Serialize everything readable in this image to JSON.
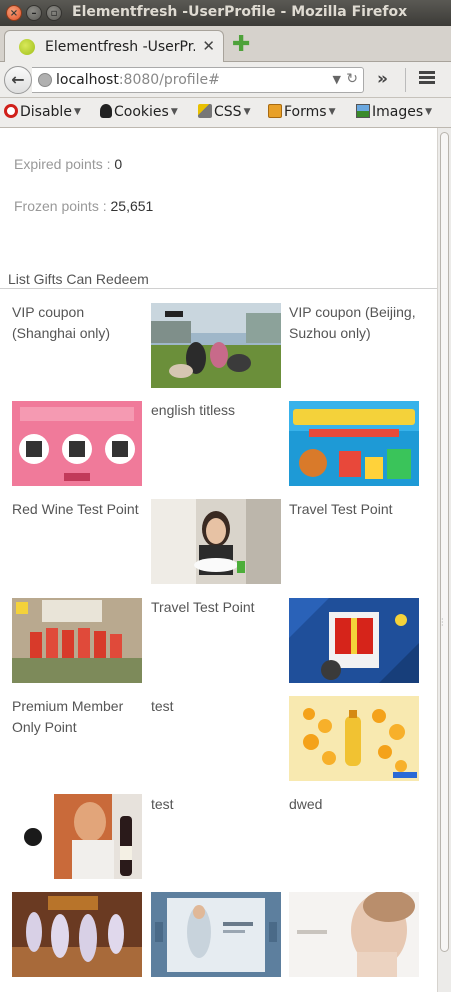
{
  "window": {
    "title": "Elementfresh -UserProfile - Mozilla Firefox"
  },
  "tab": {
    "label": "Elementfresh -UserPr...",
    "close_glyph": "✕",
    "new_tab_glyph": "✚"
  },
  "nav": {
    "url_host": "localhost",
    "url_rest": ":8080/profile#",
    "overflow_glyph": "»"
  },
  "devtoolbar": {
    "items": [
      {
        "label": "Disable",
        "icon": "disable-icon"
      },
      {
        "label": "Cookies",
        "icon": "cookies-icon"
      },
      {
        "label": "CSS",
        "icon": "css-icon"
      },
      {
        "label": "Forms",
        "icon": "forms-icon"
      },
      {
        "label": "Images",
        "icon": "images-icon"
      }
    ]
  },
  "points": {
    "expired_label": "Expired points",
    "expired_value": "0",
    "frozen_label": "Frozen points",
    "frozen_value": "25,651",
    "separator": " : "
  },
  "gifts": {
    "section_title": "List Gifts Can Redeem",
    "items": [
      {
        "name": "VIP coupon (Shanghai only)",
        "image": "adidas-outdoor-group-photo"
      },
      {
        "name": "VIP coupon (Beijing, Suzhou only)",
        "image": "pink-qr-codes-banner"
      },
      {
        "name": "english titless",
        "image": "colorful-sale-banner"
      },
      {
        "name": "Red Wine Test Point",
        "image": "woman-dining-photo"
      },
      {
        "name": "Travel Test Point",
        "image": "kids-soccer-team-photo"
      },
      {
        "name": "Travel Test Point",
        "image": "red-gift-box-graphic"
      },
      {
        "name": "Premium Member Only Point",
        "image": "orange-bubbles-ad"
      },
      {
        "name": "test",
        "image": "man-with-wine-bottle"
      },
      {
        "name": "test",
        "image": "ballet-dancers-photo"
      },
      {
        "name": "dwed",
        "image": "fashion-slider-banner"
      },
      {
        "name": "",
        "image": "cosmetics-model-portrait"
      }
    ]
  },
  "colors": {
    "link_gray": "#999999",
    "value_dark": "#333333",
    "text_gray": "#555555"
  }
}
